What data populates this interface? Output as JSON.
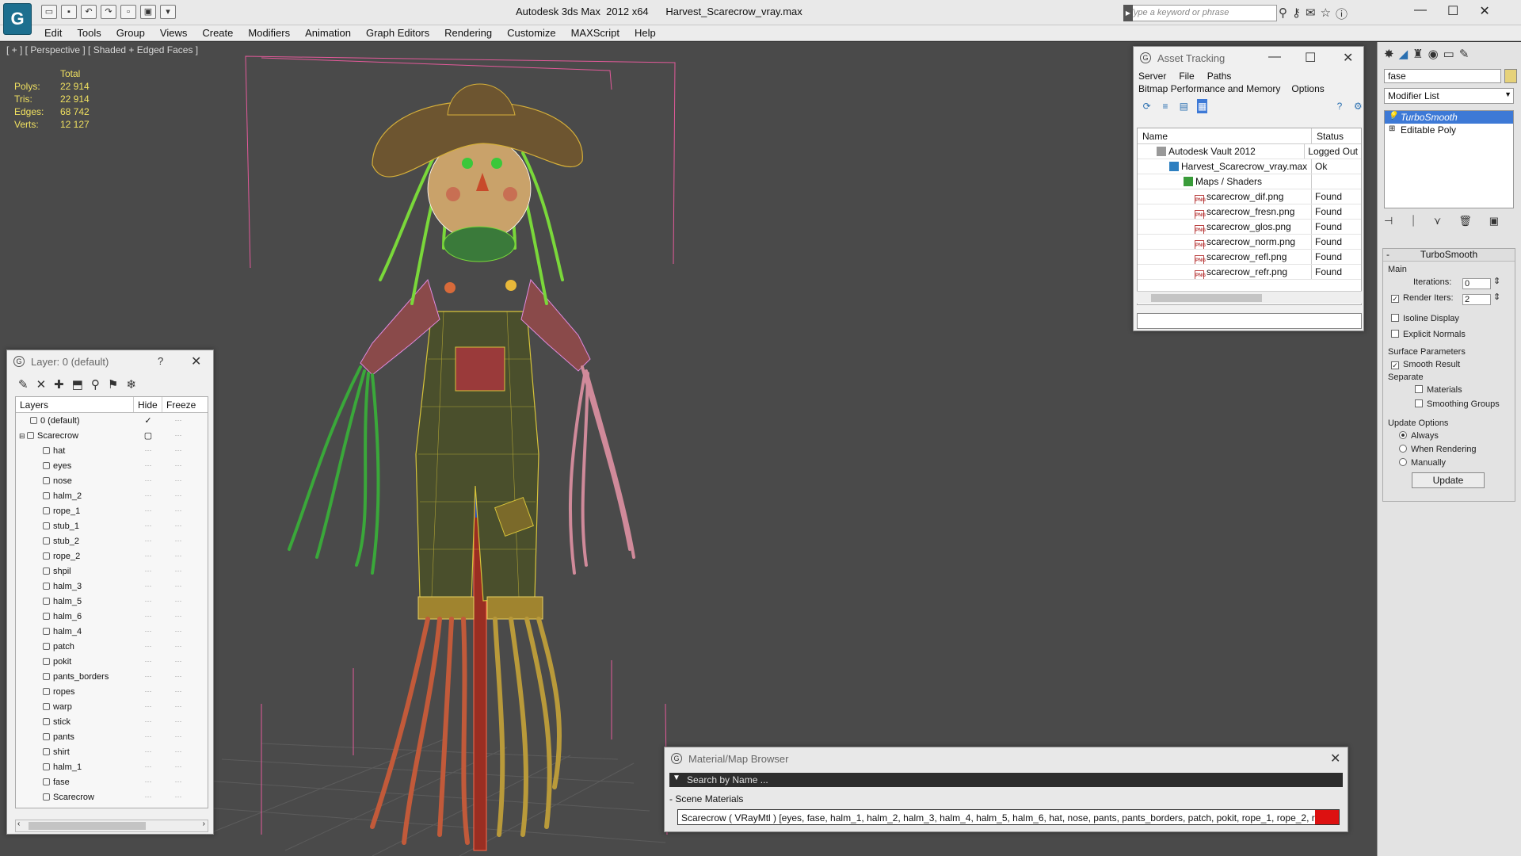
{
  "app": {
    "title": "Autodesk 3ds Max  2012 x64      Harvest_Scarecrow_vray.max",
    "logo_letter": "G",
    "keyword_placeholder": "Type a keyword or phrase"
  },
  "menu": [
    "Edit",
    "Tools",
    "Group",
    "Views",
    "Create",
    "Modifiers",
    "Animation",
    "Graph Editors",
    "Rendering",
    "Customize",
    "MAXScript",
    "Help"
  ],
  "viewport": {
    "label": "[ + ] [ Perspective ] [ Shaded + Edged Faces ]",
    "stats": {
      "header": "Total",
      "rows": [
        {
          "k": "Polys:",
          "v": "22 914"
        },
        {
          "k": "Tris:",
          "v": "22 914"
        },
        {
          "k": "Edges:",
          "v": "68 742"
        },
        {
          "k": "Verts:",
          "v": "12 127"
        }
      ]
    }
  },
  "asset_tracking": {
    "title": "Asset Tracking",
    "menu1": [
      "Server",
      "File",
      "Paths"
    ],
    "menu2": [
      "Bitmap Performance and Memory",
      "Options"
    ],
    "columns": [
      "Name",
      "Status"
    ],
    "rows": [
      {
        "name": "Autodesk Vault 2012",
        "status": "Logged Out",
        "indent": 24,
        "icon": "vault"
      },
      {
        "name": "Harvest_Scarecrow_vray.max",
        "status": "Ok",
        "indent": 40,
        "icon": "file"
      },
      {
        "name": "Maps / Shaders",
        "status": "",
        "indent": 58,
        "icon": "folder"
      },
      {
        "name": "scarecrow_dif.png",
        "status": "Found",
        "indent": 72,
        "icon": "png"
      },
      {
        "name": "scarecrow_fresn.png",
        "status": "Found",
        "indent": 72,
        "icon": "png"
      },
      {
        "name": "scarecrow_glos.png",
        "status": "Found",
        "indent": 72,
        "icon": "png"
      },
      {
        "name": "scarecrow_norm.png",
        "status": "Found",
        "indent": 72,
        "icon": "png"
      },
      {
        "name": "scarecrow_refl.png",
        "status": "Found",
        "indent": 72,
        "icon": "png"
      },
      {
        "name": "scarecrow_refr.png",
        "status": "Found",
        "indent": 72,
        "icon": "png"
      }
    ]
  },
  "layer": {
    "title": "Layer: 0 (default)",
    "help": "?",
    "columns": [
      "Layers",
      "Hide",
      "Freeze"
    ],
    "rows": [
      {
        "name": "0 (default)",
        "indent": 18,
        "check": "✓"
      },
      {
        "name": "Scarecrow",
        "indent": 18,
        "check": "▢",
        "expand": "⊟"
      },
      {
        "name": "hat",
        "indent": 34
      },
      {
        "name": "eyes",
        "indent": 34
      },
      {
        "name": "nose",
        "indent": 34
      },
      {
        "name": "halm_2",
        "indent": 34
      },
      {
        "name": "rope_1",
        "indent": 34
      },
      {
        "name": "stub_1",
        "indent": 34
      },
      {
        "name": "stub_2",
        "indent": 34
      },
      {
        "name": "rope_2",
        "indent": 34
      },
      {
        "name": "shpil",
        "indent": 34
      },
      {
        "name": "halm_3",
        "indent": 34
      },
      {
        "name": "halm_5",
        "indent": 34
      },
      {
        "name": "halm_6",
        "indent": 34
      },
      {
        "name": "halm_4",
        "indent": 34
      },
      {
        "name": "patch",
        "indent": 34
      },
      {
        "name": "pokit",
        "indent": 34
      },
      {
        "name": "pants_borders",
        "indent": 34
      },
      {
        "name": "ropes",
        "indent": 34
      },
      {
        "name": "warp",
        "indent": 34
      },
      {
        "name": "stick",
        "indent": 34
      },
      {
        "name": "pants",
        "indent": 34
      },
      {
        "name": "shirt",
        "indent": 34
      },
      {
        "name": "halm_1",
        "indent": 34
      },
      {
        "name": "fase",
        "indent": 34
      },
      {
        "name": "Scarecrow",
        "indent": 34
      }
    ]
  },
  "material_browser": {
    "title": "Material/Map Browser",
    "search_placeholder": "Search by Name ...",
    "section": "- Scene Materials",
    "item": "Scarecrow  ( VRayMtl )  [eyes, fase, halm_1, halm_2, halm_3, halm_4, halm_5, halm_6, hat, nose, pants, pants_borders, patch, pokit, rope_1, rope_2, ropes, shir..."
  },
  "command_panel": {
    "object_name": "fase",
    "object_color": "#e6d27a",
    "modifier_list": "Modifier List",
    "stack": [
      "TurboSmooth",
      "Editable Poly"
    ],
    "rollout": "TurboSmooth",
    "main_group": "Main",
    "iterations_label": "Iterations:",
    "iterations": "0",
    "render_iters_label": "Render Iters:",
    "render_iters": "2",
    "isoline": "Isoline Display",
    "explicit": "Explicit Normals",
    "surface_group": "Surface Parameters",
    "smooth_result": "Smooth Result",
    "separate": "Separate",
    "materials": "Materials",
    "smoothing_groups": "Smoothing Groups",
    "update_group": "Update Options",
    "always": "Always",
    "when_rendering": "When Rendering",
    "manually": "Manually",
    "update": "Update"
  },
  "colors": {
    "viewport_bg": "#4a4a4a",
    "selection": "#3d79d6",
    "stats": "#f0e060"
  }
}
